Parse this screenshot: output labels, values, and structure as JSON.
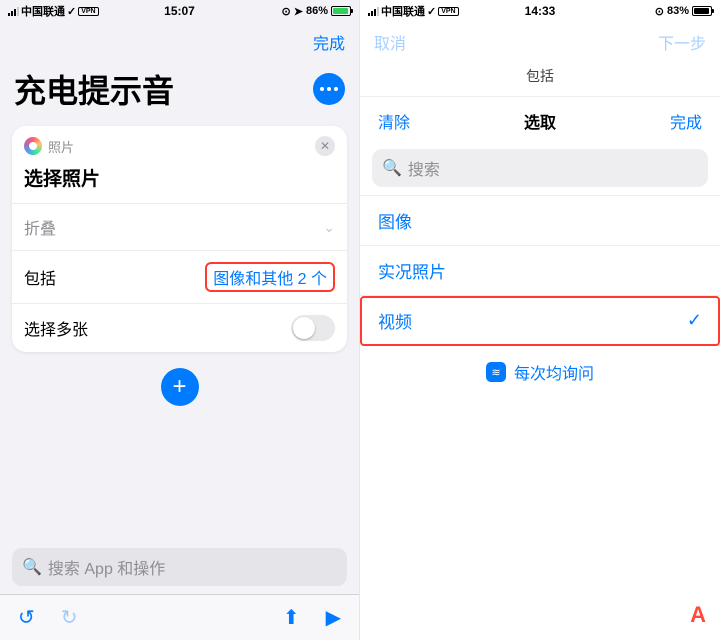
{
  "left": {
    "status": {
      "carrier": "中国联通",
      "vpn": "VPN",
      "time": "15:07",
      "battery": "86%"
    },
    "done": "完成",
    "title": "充电提示音",
    "card": {
      "app": "照片",
      "action": "选择照片",
      "collapse": "折叠",
      "include_label": "包括",
      "include_value": "图像和其他 2 个",
      "multi_label": "选择多张"
    },
    "search_placeholder": "搜索 App 和操作"
  },
  "right": {
    "status": {
      "carrier": "中国联通",
      "vpn": "VPN",
      "time": "14:33",
      "battery": "83%"
    },
    "faded_left": "取消",
    "faded_right": "下一步",
    "sheet_title": "包括",
    "clear": "清除",
    "select": "选取",
    "done": "完成",
    "search_placeholder": "搜索",
    "items": [
      "图像",
      "实况照片",
      "视频"
    ],
    "ask": "每次均询问"
  }
}
